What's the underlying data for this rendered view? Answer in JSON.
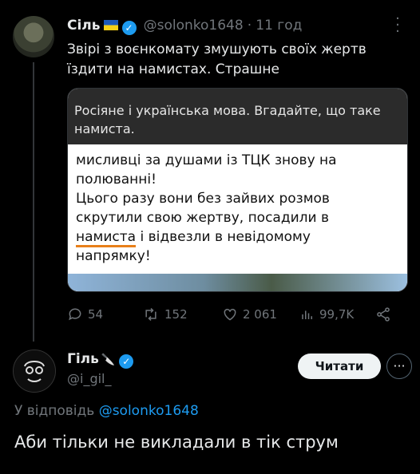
{
  "tweet1": {
    "display_name": "Сіль",
    "handle": "@solonko1648",
    "separator": "·",
    "time": "11 год",
    "text_line1": "Звірі з воєнкомату змушують своїх жертв",
    "text_line2": "їздити на намистах. Страшне",
    "media": {
      "top_line1": "Росіяне і українська мова. Вгадайте, що таке",
      "top_line2": "намиста.",
      "body_line1": "мисливці за душами із ТЦК знову на",
      "body_line2": "полюванні!",
      "body_line3": "Цього разу вони без зайвих розмов",
      "body_line4": "скрутили свою жертву, посадили в",
      "body_word_underlined": "намиста",
      "body_line5_rest": " і відвезли в невідомому",
      "body_line6": "напрямку!"
    },
    "actions": {
      "replies": "54",
      "retweets": "152",
      "likes": "2 061",
      "views": "99,7K"
    }
  },
  "tweet2": {
    "display_name": "Гіль",
    "handle": "@i_gil_",
    "follow_label": "Читати",
    "reply_prefix": "У відповідь",
    "reply_to": "@solonko1648",
    "text": "Аби тільки не викладали в тік струм"
  },
  "colors": {
    "background": "#000000",
    "text": "#e7e9ea",
    "muted": "#71767b",
    "accent": "#1d9bf0",
    "underline": "#e8801a"
  }
}
